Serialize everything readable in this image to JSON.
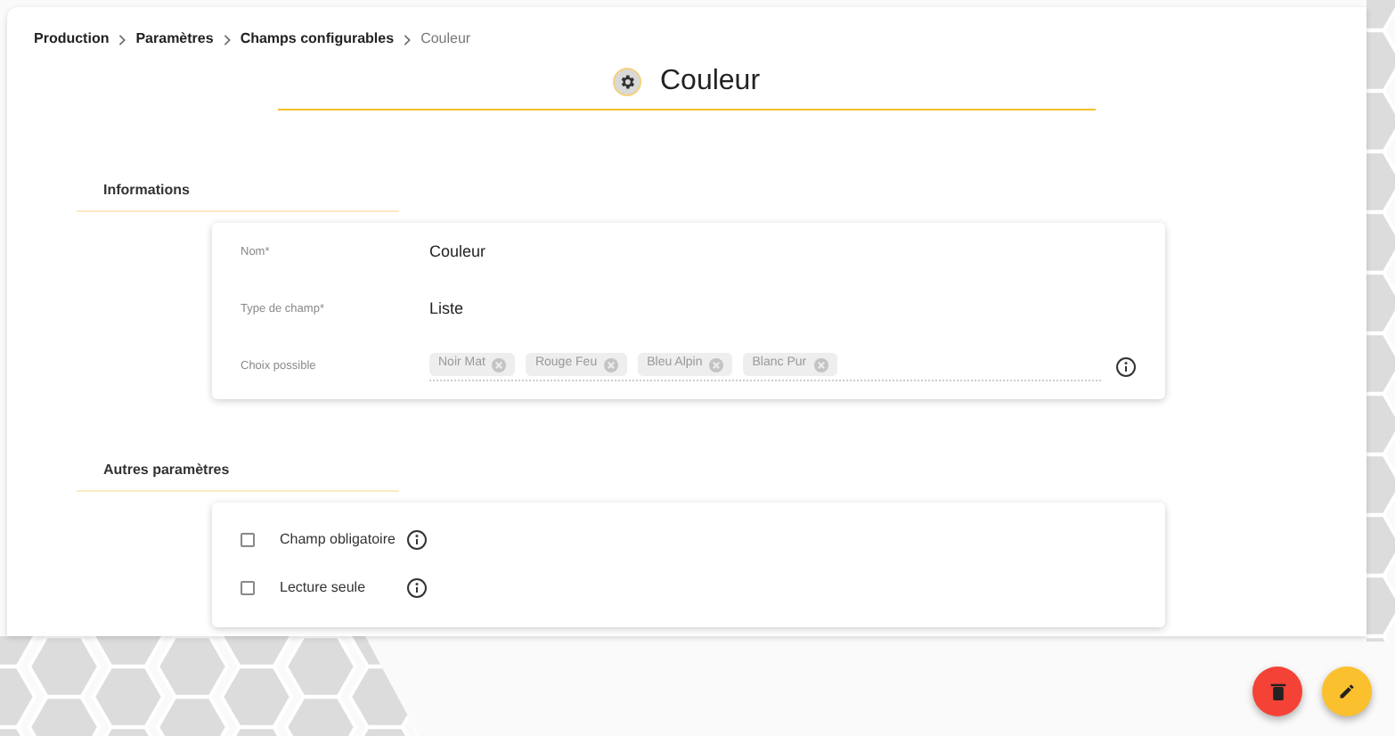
{
  "breadcrumb": [
    {
      "label": "Production",
      "current": false
    },
    {
      "label": "Paramètres",
      "current": false
    },
    {
      "label": "Champs configurables",
      "current": false
    },
    {
      "label": "Couleur",
      "current": true
    }
  ],
  "title": "Couleur",
  "sections": [
    {
      "heading": "Informations",
      "kind": "fields",
      "fields": [
        {
          "label": "Nom*",
          "kind": "text",
          "value": "Couleur"
        },
        {
          "label": "Type de champ*",
          "kind": "text",
          "value": "Liste"
        },
        {
          "label": "Choix possible",
          "kind": "chips",
          "chips": [
            "Noir Mat",
            "Rouge Feu",
            "Bleu Alpin",
            "Blanc Pur"
          ]
        }
      ]
    },
    {
      "heading": "Autres paramètres",
      "kind": "checks",
      "checks": [
        {
          "label": "Champ obligatoire",
          "checked": false
        },
        {
          "label": "Lecture seule",
          "checked": false
        }
      ]
    }
  ]
}
